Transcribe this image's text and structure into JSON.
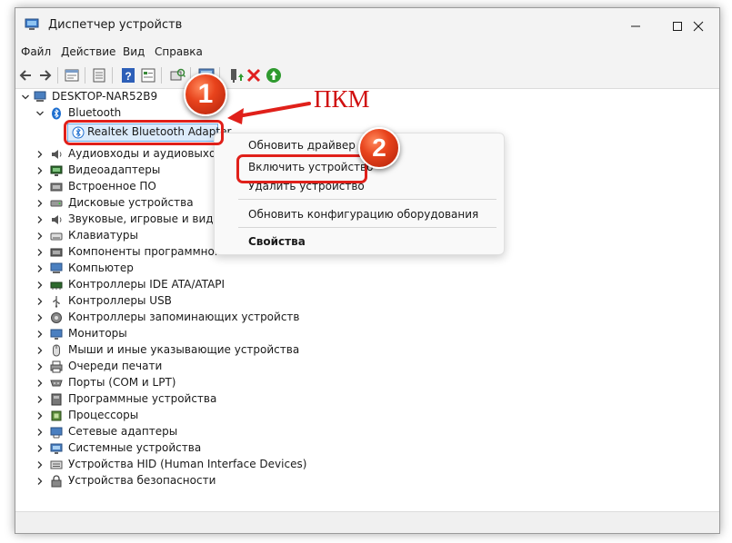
{
  "window": {
    "title": "Диспетчер устройств",
    "controls": {
      "minimize": "—",
      "maximize": "☐",
      "close": "✕"
    }
  },
  "menu": {
    "items": [
      "Файл",
      "Действие",
      "Вид",
      "Справка"
    ]
  },
  "toolbar": {
    "buttons": [
      "back-icon",
      "forward-icon",
      "properties-icon",
      "hidden-devices-icon",
      "help-icon",
      "resource-view-icon",
      "scan-hardware-icon",
      "monitor-icon",
      "update-driver-icon",
      "uninstall-icon",
      "enable-icon"
    ]
  },
  "tree": {
    "root": "DESKTOP-NAR52B9",
    "expanded_category": "Bluetooth",
    "selected_device": "Realtek Bluetooth Adapter",
    "categories": [
      "Аудиовходы и аудиовыходы",
      "Видеоадаптеры",
      "Встроенное ПО",
      "Дисковые устройства",
      "Звуковые, игровые и видеоу",
      "Клавиатуры",
      "Компоненты программного",
      "Компьютер",
      "Контроллеры IDE ATA/ATAPI",
      "Контроллеры USB",
      "Контроллеры запоминающих устройств",
      "Мониторы",
      "Мыши и иные указывающие устройства",
      "Очереди печати",
      "Порты (COM и LPT)",
      "Программные устройства",
      "Процессоры",
      "Сетевые адаптеры",
      "Системные устройства",
      "Устройства HID (Human Interface Devices)",
      "Устройства безопасности"
    ]
  },
  "context_menu": {
    "items": [
      "Обновить драйвер",
      "Включить устройство",
      "Удалить устройство",
      "Обновить конфигурацию оборудования",
      "Свойства"
    ]
  },
  "annotations": {
    "callout_1": "1",
    "callout_2": "2",
    "label": "ПКМ",
    "color": "#e0201a"
  }
}
